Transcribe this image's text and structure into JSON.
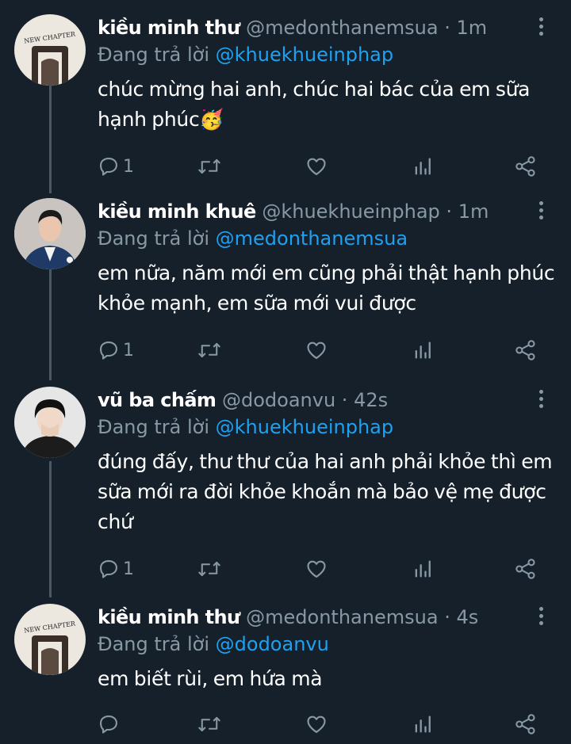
{
  "tweets": [
    {
      "name": "kiều minh thư",
      "handle": "@medonthanemsua",
      "dot": "·",
      "time": "1m",
      "reply_prefix": "Đang trả lời",
      "reply_to": "@khuekhueinphap",
      "text": "chúc mừng hai anh, chúc hai bác của em sữa hạnh phúc🥳",
      "reply_count": "1",
      "avatar_text": "NEW CHAPTER"
    },
    {
      "name": "kiều minh khuê",
      "handle": "@khuekhueinphap",
      "dot": "·",
      "time": "1m",
      "reply_prefix": "Đang trả lời",
      "reply_to": "@medonthanemsua",
      "text": "em nữa, năm mới em cũng phải thật hạnh phúc khỏe mạnh, em sữa mới vui được",
      "reply_count": "1"
    },
    {
      "name": "vũ ba chấm",
      "handle": "@dodoanvu",
      "dot": "·",
      "time": "42s",
      "reply_prefix": "Đang trả lời",
      "reply_to": "@khuekhueinphap",
      "text": "đúng đấy, thư thư của hai anh phải khỏe thì em sữa mới ra đời khỏe khoắn mà bảo vệ mẹ được chứ",
      "reply_count": "1"
    },
    {
      "name": "kiều minh thư",
      "handle": "@medonthanemsua",
      "dot": "·",
      "time": "4s",
      "reply_prefix": "Đang trả lời",
      "reply_to": "@dodoanvu",
      "text": "em biết rùi, em hứa mà",
      "reply_count": "",
      "avatar_text": "NEW CHAPTER"
    }
  ],
  "icons": {
    "reply": "reply-icon",
    "retweet": "retweet-icon",
    "like": "like-icon",
    "analytics": "analytics-icon",
    "share": "share-icon",
    "more": "more-icon"
  },
  "colors": {
    "background": "#15202b",
    "secondary_text": "#8899a6",
    "mention": "#1da1f2",
    "thread_line": "#4a5865"
  }
}
